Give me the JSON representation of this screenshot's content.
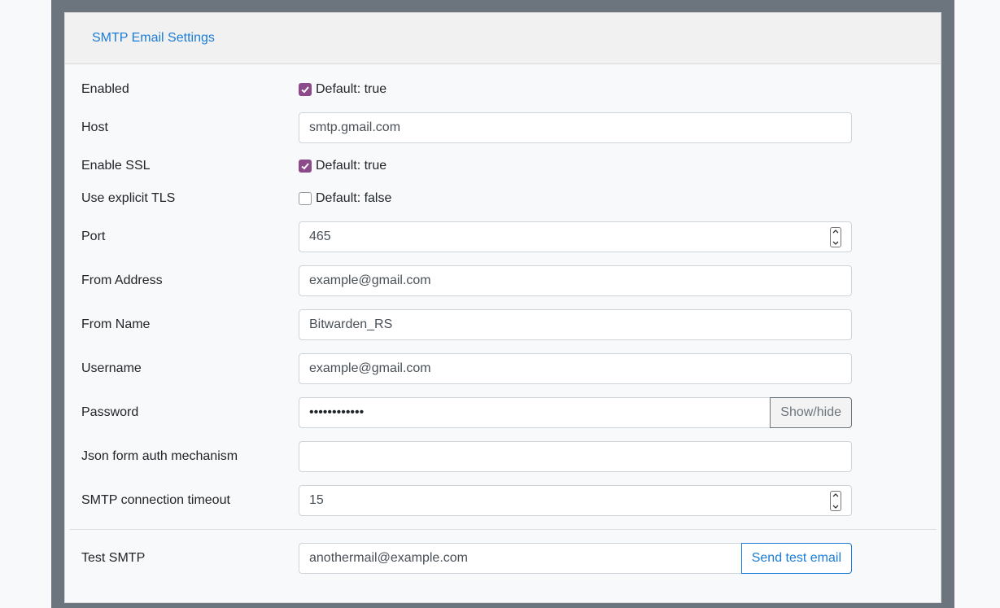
{
  "header": {
    "title": "SMTP Email Settings"
  },
  "fields": {
    "enabled": {
      "label": "Enabled",
      "hint": "Default: true",
      "checked": true
    },
    "host": {
      "label": "Host",
      "value": "smtp.gmail.com"
    },
    "enable_ssl": {
      "label": "Enable SSL",
      "hint": "Default: true",
      "checked": true
    },
    "explicit_tls": {
      "label": "Use explicit TLS",
      "hint": "Default: false",
      "checked": false
    },
    "port": {
      "label": "Port",
      "value": "465"
    },
    "from_address": {
      "label": "From Address",
      "value": "example@gmail.com"
    },
    "from_name": {
      "label": "From Name",
      "value": "Bitwarden_RS"
    },
    "username": {
      "label": "Username",
      "value": "example@gmail.com"
    },
    "password": {
      "label": "Password",
      "value": "••••••••••••",
      "toggle_label": "Show/hide"
    },
    "auth_mechanism": {
      "label": "Json form auth mechanism",
      "value": ""
    },
    "timeout": {
      "label": "SMTP connection timeout",
      "value": "15"
    },
    "test_smtp": {
      "label": "Test SMTP",
      "value": "anothermail@example.com",
      "button_label": "Send test email"
    }
  },
  "colors": {
    "accent": "#1a7cd6",
    "checkbox": "#8c4a8a"
  }
}
